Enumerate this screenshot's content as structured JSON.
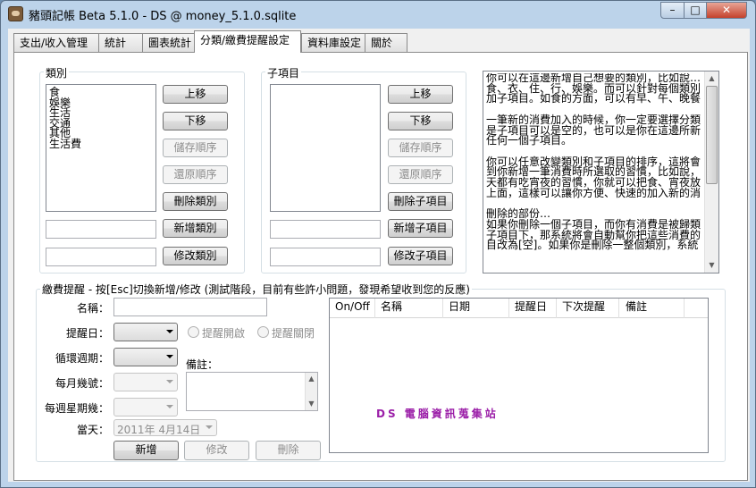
{
  "window": {
    "title": "豬頭記帳 Beta 5.1.0 - DS @ money_5.1.0.sqlite",
    "min": "–",
    "max": "□",
    "close": "✕"
  },
  "tabs": [
    {
      "label": "支出/收入管理"
    },
    {
      "label": "統計"
    },
    {
      "label": "圖表統計"
    },
    {
      "label": "分類/繳費提醒設定",
      "active": true
    },
    {
      "label": "資料庫設定"
    },
    {
      "label": "關於"
    }
  ],
  "category": {
    "label": "類別",
    "items": [
      "食",
      "娛樂",
      "生活",
      "交通",
      "其他",
      "生活費"
    ],
    "buttons": {
      "up": "上移",
      "down": "下移",
      "save_order": "儲存順序",
      "restore_order": "還原順序",
      "delete": "刪除類別",
      "add": "新增類別",
      "edit": "修改類別"
    }
  },
  "subitem": {
    "label": "子項目",
    "items": [],
    "buttons": {
      "up": "上移",
      "down": "下移",
      "save_order": "儲存順序",
      "restore_order": "還原順序",
      "delete": "刪除子項目",
      "add": "新增子項目",
      "edit": "修改子項目"
    }
  },
  "help_text": "你可以在這邊新增自己想要的類別，比如說…\n食、衣、住、行、娛樂。而可以針對每個類別\n加子項目。如食的方面，可以有早、午、晚餐\n\n一筆新的消費加入的時候，你一定要選擇分類\n是子項目可以是空的，也可以是你在這邊所新\n任何一個子項目。\n\n你可以任意改變類別和子項目的排序，這將會\n到你新增一筆消費時所選取的習慣，比如說，\n天都有吃宵夜的習慣，你就可以把食、宵夜放\n上面，這樣可以讓你方便、快速的加入新的消\n\n刪除的部份…\n如果你刪除一個子項目，而你有消費是被歸類\n子項目下，那系統將會自動幫你把這些消費的\n目改為[空]。如果你是刪除一整個類別，系統",
  "reminder": {
    "label": "繳費提醒 - 按[Esc]切換新增/修改 (測試階段，目前有些許小問題，發現希望收到您的反應)",
    "name_label": "名稱：",
    "name_value": "",
    "remind_day_label": "提醒日：",
    "remind_on": "提醒開啟",
    "remind_off": "提醒關閉",
    "cycle_label": "循環週期：",
    "monthly_label": "每月幾號：",
    "weekly_label": "每週星期幾：",
    "note_label": "備註：",
    "date_label": "當天：",
    "date_value": "2011年  4月14日",
    "buttons": {
      "add": "新增",
      "edit": "修改",
      "delete": "刪除"
    },
    "grid_columns": [
      "On/Off",
      "名稱",
      "日期",
      "提醒日",
      "下次提醒",
      "備註"
    ]
  },
  "watermark": "DS 電腦資訊蒐集站"
}
